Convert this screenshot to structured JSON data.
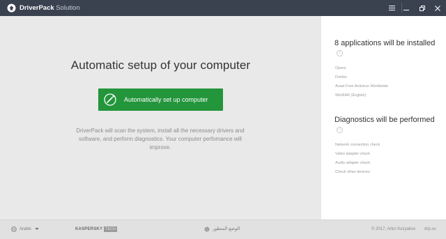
{
  "titlebar": {
    "app_name_bold": "DriverPack",
    "app_name_light": "Solution",
    "icons": [
      "driverpack-logo-icon",
      "menu-icon",
      "minimize-icon",
      "restore-icon",
      "close-icon"
    ]
  },
  "main": {
    "headline": "Automatic setup of your computer",
    "cta_label": "Automatically set up computer",
    "cta_icon": "magic-wand-icon",
    "description": "DriverPack will scan the system, install all the necessary drivers and software, and perform diagnostics. Your computer perfomance will improve."
  },
  "sidebar": {
    "apps_title": "8 applications will be installed",
    "apps": [
      "Opera",
      "Firefox",
      "Avast Free Antivirus Worldwide",
      "WinRAR (English)"
    ],
    "diagnostics_title": "Diagnostics will be performed",
    "diagnostics": [
      "Network connection check",
      "Video adapter check",
      "Audio adapter check",
      "Check other devices"
    ],
    "info_glyph": "i"
  },
  "footer": {
    "language": "Arabic",
    "kaspersky_word": "KASPERSKY",
    "kaspersky_tag": "TECH",
    "expert_mode": "الوضع المتطور",
    "copyright": "© 2017, Artur Kuzyakov",
    "site": "drp.su"
  },
  "colors": {
    "titlebar": "#3a4250",
    "accent_green": "#23953b",
    "main_bg": "#e9e9e9",
    "sidebar_bg": "#ffffff",
    "footer_bg": "#e1e1e1"
  }
}
